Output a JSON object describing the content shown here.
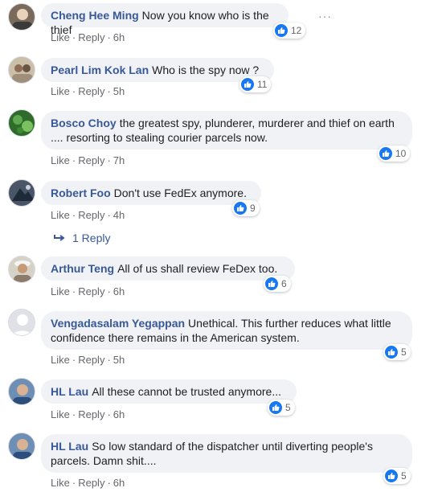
{
  "comments": [
    {
      "author": "Cheng Hee Ming",
      "text": "Now you know who is the thief",
      "like": "Like",
      "reply": "Reply",
      "time": "6h",
      "reactions": "12"
    },
    {
      "author": "Pearl Lim Kok Lan",
      "text": "Who is the spy now ?",
      "like": "Like",
      "reply": "Reply",
      "time": "5h",
      "reactions": "11"
    },
    {
      "author": "Bosco Choy",
      "text": "the greatest spy, plunderer, murderer and thief on earth .... resorting to stealing courier parcels now.",
      "like": "Like",
      "reply": "Reply",
      "time": "7h",
      "reactions": "10"
    },
    {
      "author": "Robert Foo",
      "text": "Don't use FedEx anymore.",
      "like": "Like",
      "reply": "Reply",
      "time": "4h",
      "reactions": "9"
    },
    {
      "author": "Arthur Teng",
      "text": "All of us shall review FeDex too.",
      "like": "Like",
      "reply": "Reply",
      "time": "6h",
      "reactions": "6"
    },
    {
      "author": "Vengadasalam Yegappan",
      "text": "Unethical. This further reduces what little confidence there remains in the American system.",
      "like": "Like",
      "reply": "Reply",
      "time": "5h",
      "reactions": "5"
    },
    {
      "author": "HL Lau",
      "text": "All these cannot be trusted anymore...",
      "like": "Like",
      "reply": "Reply",
      "time": "6h",
      "reactions": "5"
    },
    {
      "author": "HL Lau",
      "text": "So low standard of the dispatcher until diverting people's parcels. Damn shit....",
      "like": "Like",
      "reply": "Reply",
      "time": "6h",
      "reactions": "5"
    }
  ],
  "replies_link": "1 Reply",
  "more_options": "···",
  "colors": {
    "author": "#385898",
    "bubble": "#f0f2f5",
    "meta": "#65676b",
    "like_blue": "#1877f2"
  }
}
